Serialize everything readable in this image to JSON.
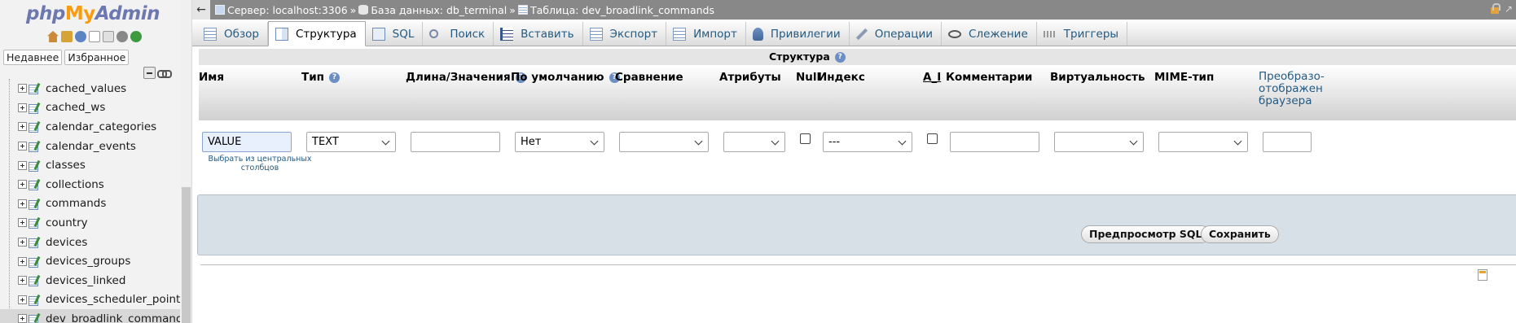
{
  "nav": {
    "logo": {
      "php": "php",
      "my": "My",
      "admin": "Admin"
    },
    "tabs": [
      "Недавнее",
      "Избранное"
    ],
    "tables": [
      "cached_values",
      "cached_ws",
      "calendar_categories",
      "calendar_events",
      "classes",
      "collections",
      "commands",
      "country",
      "devices",
      "devices_groups",
      "devices_linked",
      "devices_scheduler_points",
      "dev_broadlink_commands"
    ],
    "active_table": "dev_broadlink_commands"
  },
  "breadcrumb": {
    "server": "Сервер: localhost:3306",
    "database": "База данных: db_terminal",
    "table": "Таблица: dev_broadlink_commands",
    "separator": "»"
  },
  "tabs": [
    {
      "label": "Обзор",
      "icon": "browse-icon"
    },
    {
      "label": "Структура",
      "icon": "structure-icon",
      "active": true
    },
    {
      "label": "SQL",
      "icon": "sql-icon"
    },
    {
      "label": "Поиск",
      "icon": "search-icon"
    },
    {
      "label": "Вставить",
      "icon": "insert-icon"
    },
    {
      "label": "Экспорт",
      "icon": "export-icon"
    },
    {
      "label": "Импорт",
      "icon": "import-icon"
    },
    {
      "label": "Привилегии",
      "icon": "privileges-icon"
    },
    {
      "label": "Операции",
      "icon": "operations-icon"
    },
    {
      "label": "Слежение",
      "icon": "tracking-icon"
    },
    {
      "label": "Триггеры",
      "icon": "triggers-icon"
    }
  ],
  "section_title": "Структура",
  "columns": {
    "name": "Имя",
    "type": "Тип",
    "length": "Длина/Значения",
    "default": "По умолчанию",
    "collation": "Сравнение",
    "attributes": "Атрибуты",
    "null": "Null",
    "index": "Индекс",
    "ai": "A_I",
    "comments": "Комментарии",
    "virtuality": "Виртуальность",
    "mime": "MIME-тип",
    "transform": "Преобразо­ отображен браузера"
  },
  "row": {
    "name_value": "VALUE",
    "type_value": "TEXT",
    "length_value": "",
    "default_value": "Нет",
    "collation_value": "",
    "attributes_value": "",
    "index_value": "---",
    "comments_value": "",
    "virtuality_value": "",
    "mime_value": "",
    "central_link": "Выбрать из центральных столбцов"
  },
  "buttons": {
    "preview_sql": "Предпросмотр SQL",
    "save": "Сохранить"
  }
}
